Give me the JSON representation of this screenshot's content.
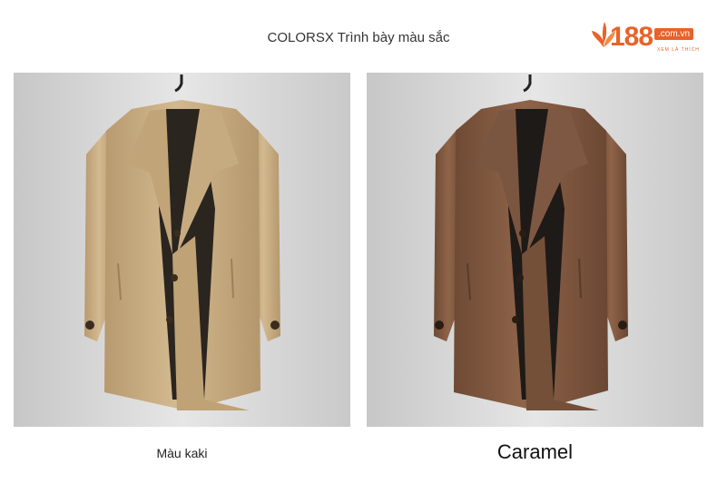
{
  "header": {
    "title": "COLORSX Trình bày màu sắc"
  },
  "logo": {
    "number": "188",
    "domain": ".com.vn",
    "tagline": "XEM LÀ THÍCH"
  },
  "products": [
    {
      "caption": "Màu kaki",
      "color": "#c9ad82"
    },
    {
      "caption": "Caramel",
      "color": "#8a5e45"
    }
  ],
  "colors": {
    "brand": "#e8622a",
    "background_gray": "#d6d6d6"
  }
}
